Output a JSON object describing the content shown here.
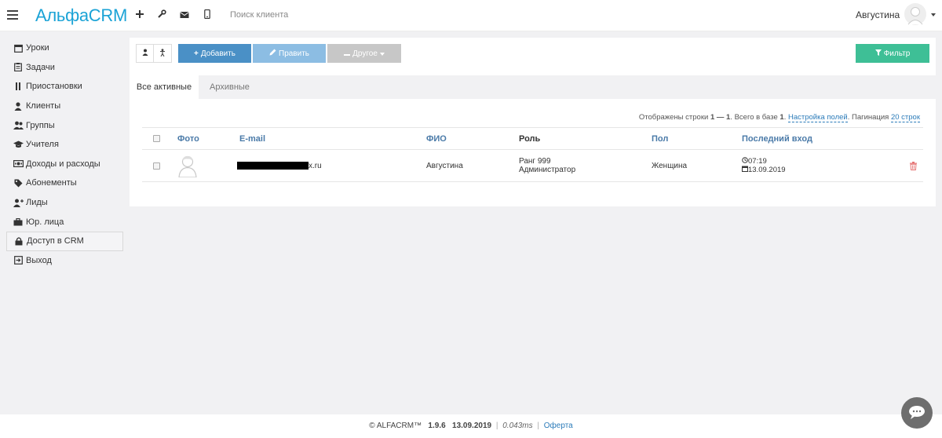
{
  "header": {
    "logo": "АльфаCRM",
    "search_placeholder": "Поиск клиента",
    "username": "Августина"
  },
  "sidebar": {
    "items": [
      {
        "label": "Уроки",
        "icon": "calendar-icon"
      },
      {
        "label": "Задачи",
        "icon": "clipboard-icon"
      },
      {
        "label": "Приостановки",
        "icon": "pause-icon"
      },
      {
        "label": "Клиенты",
        "icon": "user-icon"
      },
      {
        "label": "Группы",
        "icon": "users-icon"
      },
      {
        "label": "Учителя",
        "icon": "graduation-cap-icon"
      },
      {
        "label": "Доходы и расходы",
        "icon": "money-icon"
      },
      {
        "label": "Абонементы",
        "icon": "tag-icon"
      },
      {
        "label": "Лиды",
        "icon": "user-add-icon"
      },
      {
        "label": "Юр. лица",
        "icon": "briefcase-icon"
      },
      {
        "label": "Доступ в CRM",
        "icon": "lock-icon",
        "active": true
      },
      {
        "label": "Выход",
        "icon": "logout-icon"
      }
    ]
  },
  "toolbar": {
    "add_label": "Добавить",
    "edit_label": "Править",
    "other_label": "Другое",
    "filter_label": "Фильтр"
  },
  "tabs": [
    {
      "label": "Все активные",
      "active": true
    },
    {
      "label": "Архивные",
      "active": false
    }
  ],
  "rows_info": {
    "prefix": "Отображены строки ",
    "range": "1 — 1",
    "total_text": ". Всего в базе ",
    "total": "1",
    "dot": ".",
    "fields_link": "Настройка полей",
    "pagination_text": ". Пагинация ",
    "pagination_link": "20 строк"
  },
  "table": {
    "columns": [
      "Фото",
      "E-mail",
      "ФИО",
      "Роль",
      "Пол",
      "Последний вход"
    ],
    "rows": [
      {
        "email_suffix": "x.ru",
        "name": "Августина",
        "role_rank": "Ранг 999",
        "role_name": "Администратор",
        "gender": "Женщина",
        "last_time": "07:19",
        "last_date": "13.09.2019"
      }
    ]
  },
  "footer": {
    "brand": "© ALFACRM™",
    "version": "1.9.6",
    "date": "13.09.2019",
    "sep": "|",
    "ms": "0.043ms",
    "offer": "Оферта"
  },
  "colors": {
    "accent": "#1ba3d6",
    "add_button": "#4a90c6",
    "edit_button": "#8cbde3",
    "other_button": "#c7c7c7",
    "filter_button": "#3ebf96",
    "delete_icon": "#e57373"
  }
}
